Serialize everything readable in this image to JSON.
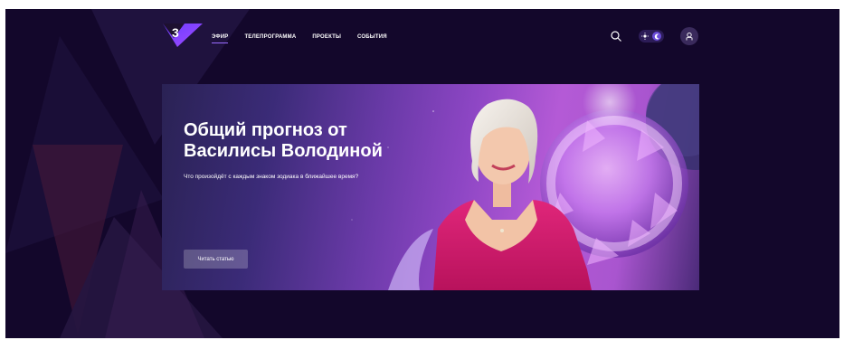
{
  "header": {
    "logo_text": "3",
    "nav": [
      {
        "label": "ЭФИР",
        "active": true
      },
      {
        "label": "ТЕЛЕПРОГРАММА",
        "active": false
      },
      {
        "label": "ПРОЕКТЫ",
        "active": false
      },
      {
        "label": "СОБЫТИЯ",
        "active": false
      }
    ],
    "icons": {
      "search": "search-icon",
      "theme_light": "sun-icon",
      "theme_dark": "moon-icon",
      "user": "user-icon"
    },
    "theme": "dark"
  },
  "banner": {
    "title_line1": "Общий прогноз от",
    "title_line2": "Василисы Володиной",
    "subtitle": "Что произойдёт с каждым знаком зодиака в ближайшее время?",
    "button_label": "Читать статью"
  },
  "colors": {
    "page_background": "#13072b",
    "accent": "#7c4dff",
    "dress": "#d81b6f"
  }
}
